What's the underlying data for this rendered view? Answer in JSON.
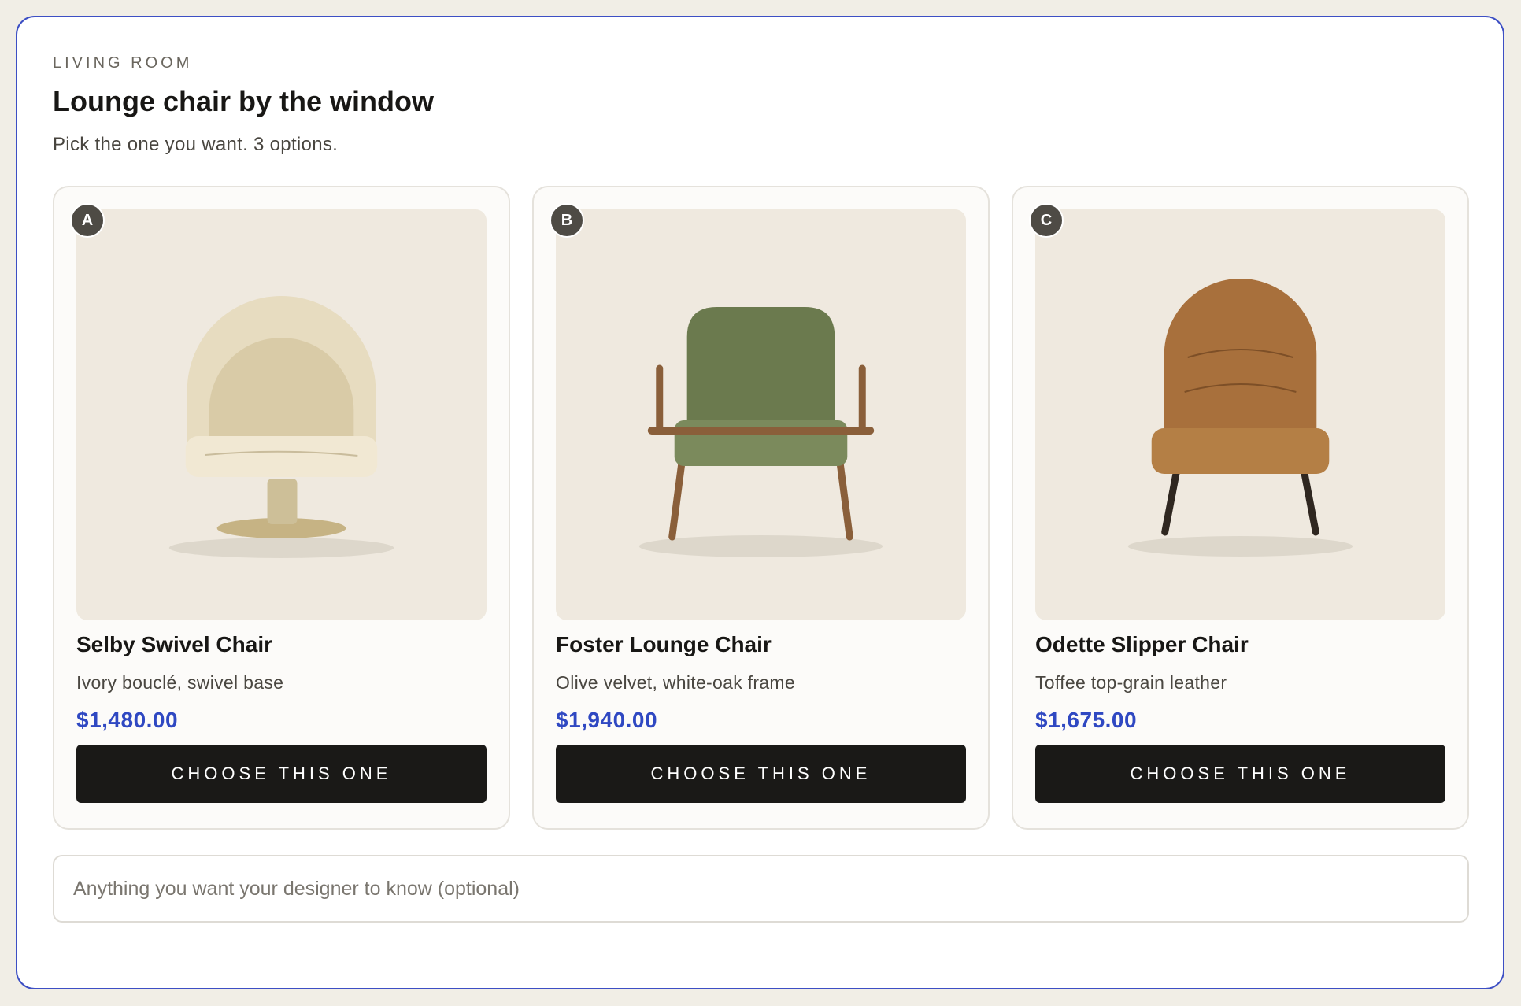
{
  "section": {
    "eyebrow": "LIVING ROOM",
    "title": "Lounge chair by the window",
    "subtitle": "Pick the one you want. 3 options."
  },
  "options": [
    {
      "badge": "A",
      "name": "Selby Swivel Chair",
      "description": "Ivory bouclé, swivel base",
      "price": "$1,480.00",
      "button_label": "CHOOSE THIS ONE",
      "image_icon": "swivel-chair-illustration"
    },
    {
      "badge": "B",
      "name": "Foster Lounge Chair",
      "description": "Olive velvet, white-oak frame",
      "price": "$1,940.00",
      "button_label": "CHOOSE THIS ONE",
      "image_icon": "lounge-chair-illustration"
    },
    {
      "badge": "C",
      "name": "Odette Slipper Chair",
      "description": "Toffee top-grain leather",
      "price": "$1,675.00",
      "button_label": "CHOOSE THIS ONE",
      "image_icon": "slipper-chair-illustration"
    }
  ],
  "note": {
    "placeholder": "Anything you want your designer to know (optional)",
    "value": ""
  },
  "colors": {
    "accent_border": "#3d4fc4",
    "price": "#2f48c2",
    "button_bg": "#1a1917",
    "page_bg": "#f1eee6"
  }
}
